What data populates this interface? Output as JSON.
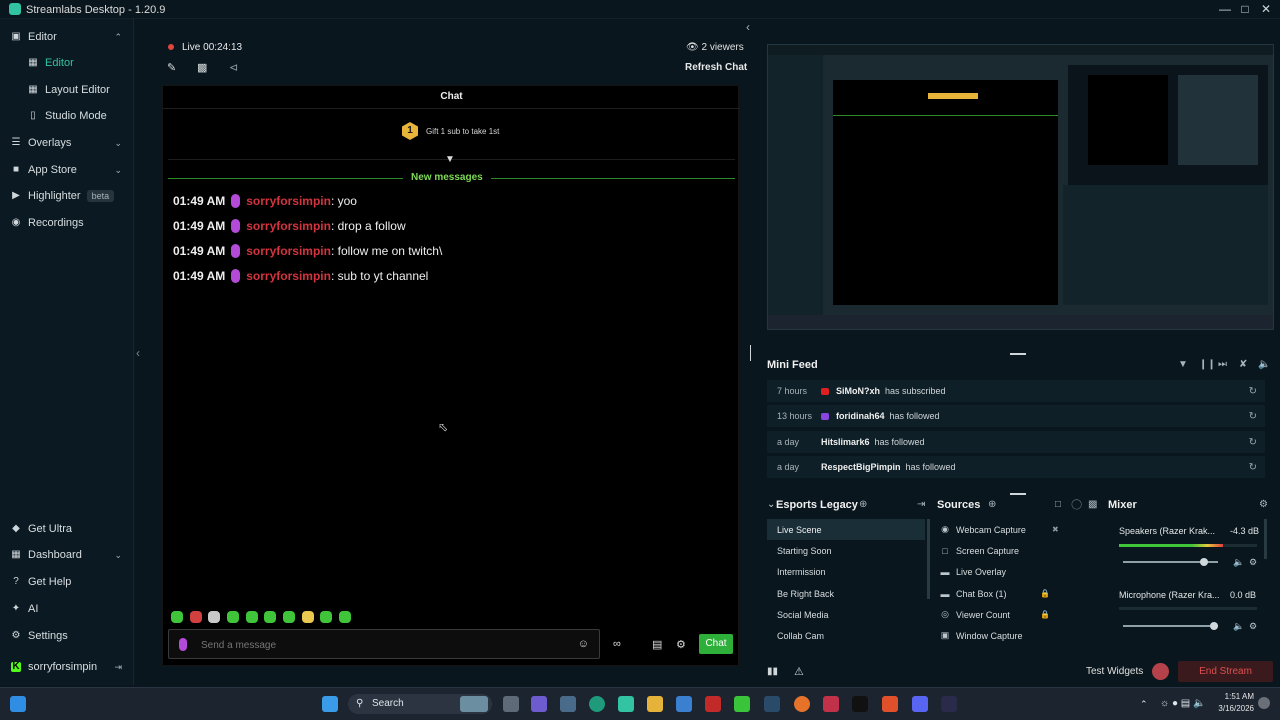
{
  "app": {
    "title": "Streamlabs Desktop - 1.20.9"
  },
  "sidebar": {
    "items": [
      {
        "label": "Editor",
        "icon": "editor-icon"
      },
      {
        "label": "Editor",
        "icon": "layout-icon"
      },
      {
        "label": "Layout Editor",
        "icon": "grid-icon"
      },
      {
        "label": "Studio Mode",
        "icon": "columns-icon"
      },
      {
        "label": "Overlays",
        "icon": "overlays-icon"
      },
      {
        "label": "App Store",
        "icon": "store-icon"
      },
      {
        "label": "Highlighter",
        "icon": "highlighter-icon",
        "badge": "beta"
      },
      {
        "label": "Recordings",
        "icon": "record-icon"
      }
    ],
    "bottom": [
      {
        "label": "Get Ultra",
        "icon": "ultra-icon"
      },
      {
        "label": "Dashboard",
        "icon": "dashboard-icon"
      },
      {
        "label": "Get Help",
        "icon": "help-icon"
      },
      {
        "label": "AI",
        "icon": "ai-icon"
      },
      {
        "label": "Settings",
        "icon": "gear-icon"
      },
      {
        "label": "sorryforsimpin",
        "icon": "kick-icon"
      }
    ]
  },
  "stream": {
    "live_label": "Live",
    "duration": "00:24:13",
    "viewers": "2 viewers",
    "refresh": "Refresh Chat"
  },
  "chat": {
    "title": "Chat",
    "gift_badge": "1",
    "gift_text": "Gift 1 sub to take 1st",
    "new_messages": "New messages",
    "messages": [
      {
        "time": "01:49 AM",
        "user": "sorryforsimpin",
        "text": ": yoo"
      },
      {
        "time": "01:49 AM",
        "user": "sorryforsimpin",
        "text": ": drop a follow"
      },
      {
        "time": "01:49 AM",
        "user": "sorryforsimpin",
        "text": ": follow me on twitch\\"
      },
      {
        "time": "01:49 AM",
        "user": "sorryforsimpin",
        "text": ": sub to yt channel"
      }
    ],
    "input_placeholder": "Send a message",
    "send": "Chat"
  },
  "minifeed": {
    "title": "Mini Feed",
    "items": [
      {
        "age": "7 hours",
        "who": "SiMoN?xh",
        "act": "has subscribed",
        "color": "#e02020"
      },
      {
        "age": "13 hours",
        "who": "foridinah64",
        "act": "has followed",
        "color": "#8a45e0"
      },
      {
        "age": "a day",
        "who": "Hitslimark6",
        "act": "has followed",
        "color": ""
      },
      {
        "age": "a day",
        "who": "RespectBigPimpin",
        "act": "has followed",
        "color": ""
      }
    ]
  },
  "scenes": {
    "title": "Esports Legacy",
    "items": [
      "Live Scene",
      "Starting Soon",
      "Intermission",
      "Be Right Back",
      "Social Media",
      "Collab Cam"
    ]
  },
  "sources": {
    "title": "Sources",
    "items": [
      {
        "label": "Webcam Capture",
        "icon": "webcam-icon"
      },
      {
        "label": "Screen Capture",
        "icon": "screen-icon"
      },
      {
        "label": "Live Overlay",
        "icon": "folder-icon"
      },
      {
        "label": "Chat Box (1)",
        "icon": "folder-icon"
      },
      {
        "label": "Viewer Count",
        "icon": "eye-icon"
      },
      {
        "label": "Window Capture",
        "icon": "window-icon"
      }
    ]
  },
  "mixer": {
    "title": "Mixer",
    "channels": [
      {
        "name": "Speakers (Razer Krak...",
        "db": "-4.3 dB",
        "level": 0.75,
        "volume": 0.85
      },
      {
        "name": "Microphone (Razer Kra...",
        "db": "0.0 dB",
        "level": 0.0,
        "volume": 0.96
      }
    ]
  },
  "footer": {
    "test_widgets": "Test Widgets",
    "end_stream": "End Stream"
  },
  "taskbar": {
    "search": "Search",
    "time": "1:51 AM",
    "date": "3/16/2026"
  }
}
